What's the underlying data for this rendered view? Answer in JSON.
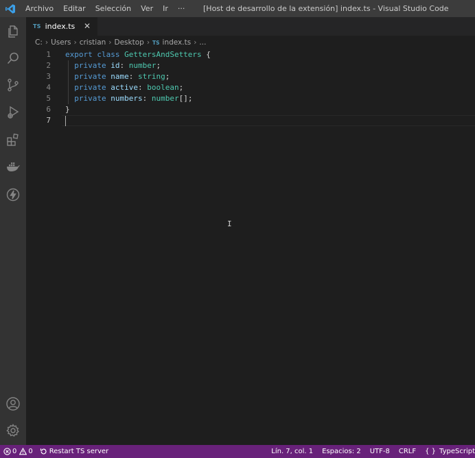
{
  "titlebar": {
    "menu": [
      "Archivo",
      "Editar",
      "Selección",
      "Ver",
      "Ir",
      "···"
    ],
    "window_title": "[Host de desarrollo de la extensión] index.ts - Visual Studio Code"
  },
  "activitybar": {
    "icons": [
      "explorer-icon",
      "search-icon",
      "source-control-icon",
      "run-debug-icon",
      "extensions-icon",
      "docker-icon",
      "lightning-icon",
      "account-icon",
      "settings-gear-icon"
    ]
  },
  "tabs": [
    {
      "badge": "TS",
      "label": "index.ts",
      "close": "✕"
    }
  ],
  "breadcrumb": {
    "parts": [
      "C:",
      "Users",
      "cristian",
      "Desktop"
    ],
    "file_badge": "TS",
    "file": "index.ts",
    "tail": "..."
  },
  "editor": {
    "line_numbers": [
      "1",
      "2",
      "3",
      "4",
      "5",
      "6",
      "7"
    ],
    "lines": [
      [
        {
          "t": "export class ",
          "c": "kw"
        },
        {
          "t": "GettersAndSetters",
          "c": "cls"
        },
        {
          "t": " {",
          "c": "punct"
        }
      ],
      [
        {
          "t": "  private ",
          "c": "kw"
        },
        {
          "t": "id",
          "c": "prop"
        },
        {
          "t": ": ",
          "c": "punct"
        },
        {
          "t": "number",
          "c": "type"
        },
        {
          "t": ";",
          "c": "punct"
        }
      ],
      [
        {
          "t": "  private ",
          "c": "kw"
        },
        {
          "t": "name",
          "c": "prop"
        },
        {
          "t": ": ",
          "c": "punct"
        },
        {
          "t": "string",
          "c": "type"
        },
        {
          "t": ";",
          "c": "punct"
        }
      ],
      [
        {
          "t": "  private ",
          "c": "kw"
        },
        {
          "t": "active",
          "c": "prop"
        },
        {
          "t": ": ",
          "c": "punct"
        },
        {
          "t": "boolean",
          "c": "type"
        },
        {
          "t": ";",
          "c": "punct"
        }
      ],
      [
        {
          "t": "  private ",
          "c": "kw"
        },
        {
          "t": "numbers",
          "c": "prop"
        },
        {
          "t": ": ",
          "c": "punct"
        },
        {
          "t": "number",
          "c": "type"
        },
        {
          "t": "[];",
          "c": "punct"
        }
      ],
      [
        {
          "t": "}",
          "c": "punct"
        }
      ],
      []
    ]
  },
  "statusbar": {
    "errors": "0",
    "warnings": "0",
    "restart_label": "Restart TS server",
    "position": "Lín. 7, col. 1",
    "spaces": "Espacios: 2",
    "encoding": "UTF-8",
    "eol": "CRLF",
    "language": "TypeScript"
  },
  "colors": {
    "statusbar_bg": "#68217a",
    "keyword": "#569cd6",
    "class_name": "#4ec9b0",
    "property": "#9cdcfe"
  }
}
